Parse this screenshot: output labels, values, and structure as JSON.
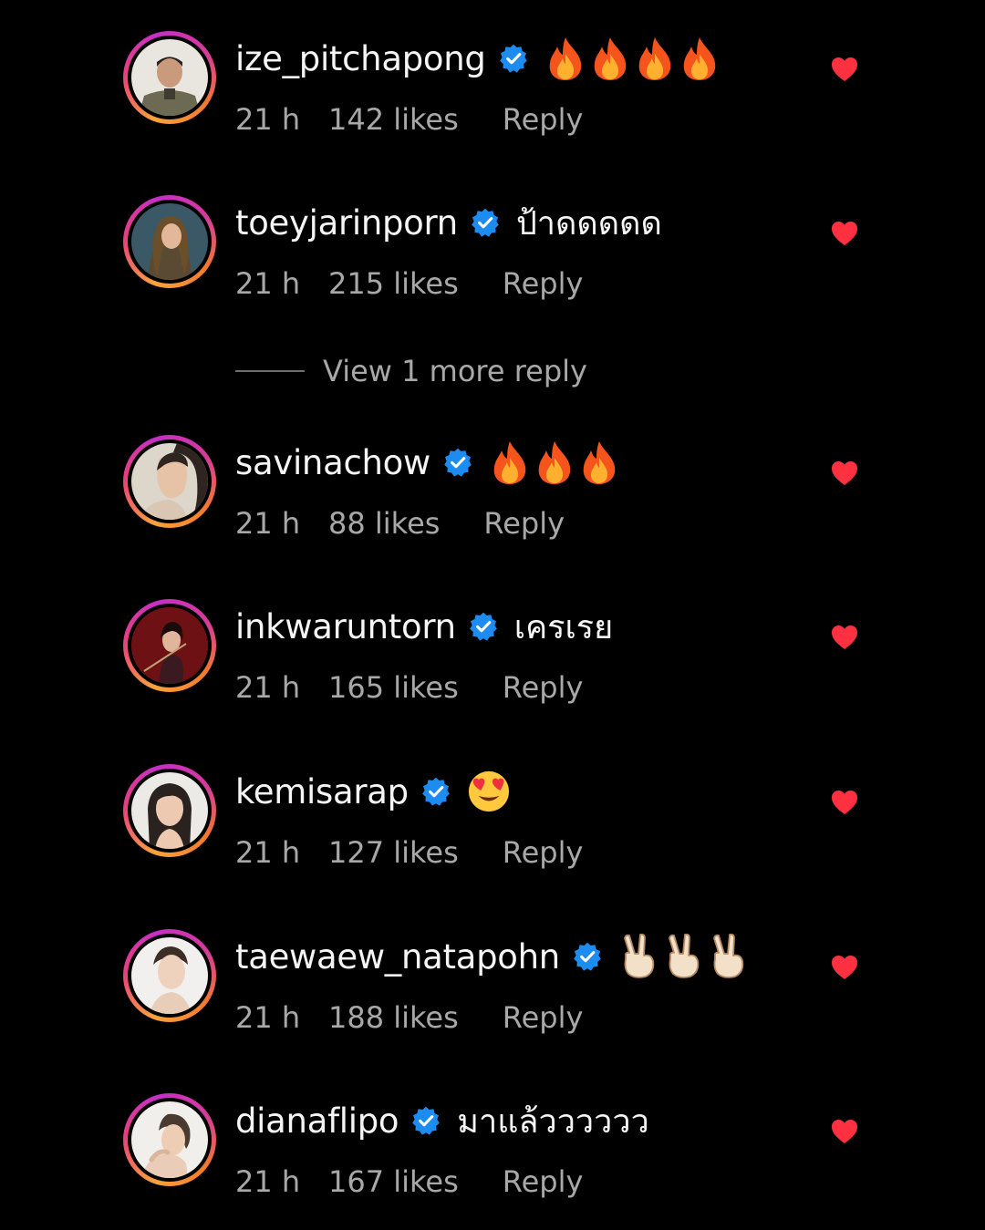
{
  "colors": {
    "background": "#000000",
    "username": "#f5f5f5",
    "meta": "#a8a8a8",
    "verified_badge": "#1d8cf0",
    "heart": "#ff3040"
  },
  "view_more_replies": "View 1 more reply",
  "comments": [
    {
      "username": "ize_pitchapong",
      "verified": true,
      "text": "",
      "emoji": [
        "fire-emoji",
        "fire-emoji",
        "fire-emoji",
        "fire-emoji"
      ],
      "time": "21 h",
      "likes": "142 likes",
      "reply": "Reply",
      "liked": true
    },
    {
      "username": "toeyjarinporn",
      "verified": true,
      "text": "ป้าดดดดด",
      "emoji": [],
      "time": "21 h",
      "likes": "215 likes",
      "reply": "Reply",
      "liked": true
    },
    {
      "username": "savinachow",
      "verified": true,
      "text": "",
      "emoji": [
        "fire-emoji",
        "fire-emoji",
        "fire-emoji"
      ],
      "time": "21 h",
      "likes": "88 likes",
      "reply": "Reply",
      "liked": true
    },
    {
      "username": "inkwaruntorn",
      "verified": true,
      "text": "เครเรย",
      "emoji": [],
      "time": "21 h",
      "likes": "165 likes",
      "reply": "Reply",
      "liked": true
    },
    {
      "username": "kemisarap",
      "verified": true,
      "text": "",
      "emoji": [
        "heart-eyes-emoji"
      ],
      "time": "21 h",
      "likes": "127 likes",
      "reply": "Reply",
      "liked": true
    },
    {
      "username": "taewaew_natapohn",
      "verified": true,
      "text": "",
      "emoji": [
        "victory-hand-emoji",
        "victory-hand-emoji",
        "victory-hand-emoji"
      ],
      "time": "21 h",
      "likes": "188 likes",
      "reply": "Reply",
      "liked": true
    },
    {
      "username": "dianaflipo",
      "verified": true,
      "text": "มาแล้วววววว",
      "emoji": [],
      "time": "21 h",
      "likes": "167 likes",
      "reply": "Reply",
      "liked": true
    }
  ]
}
